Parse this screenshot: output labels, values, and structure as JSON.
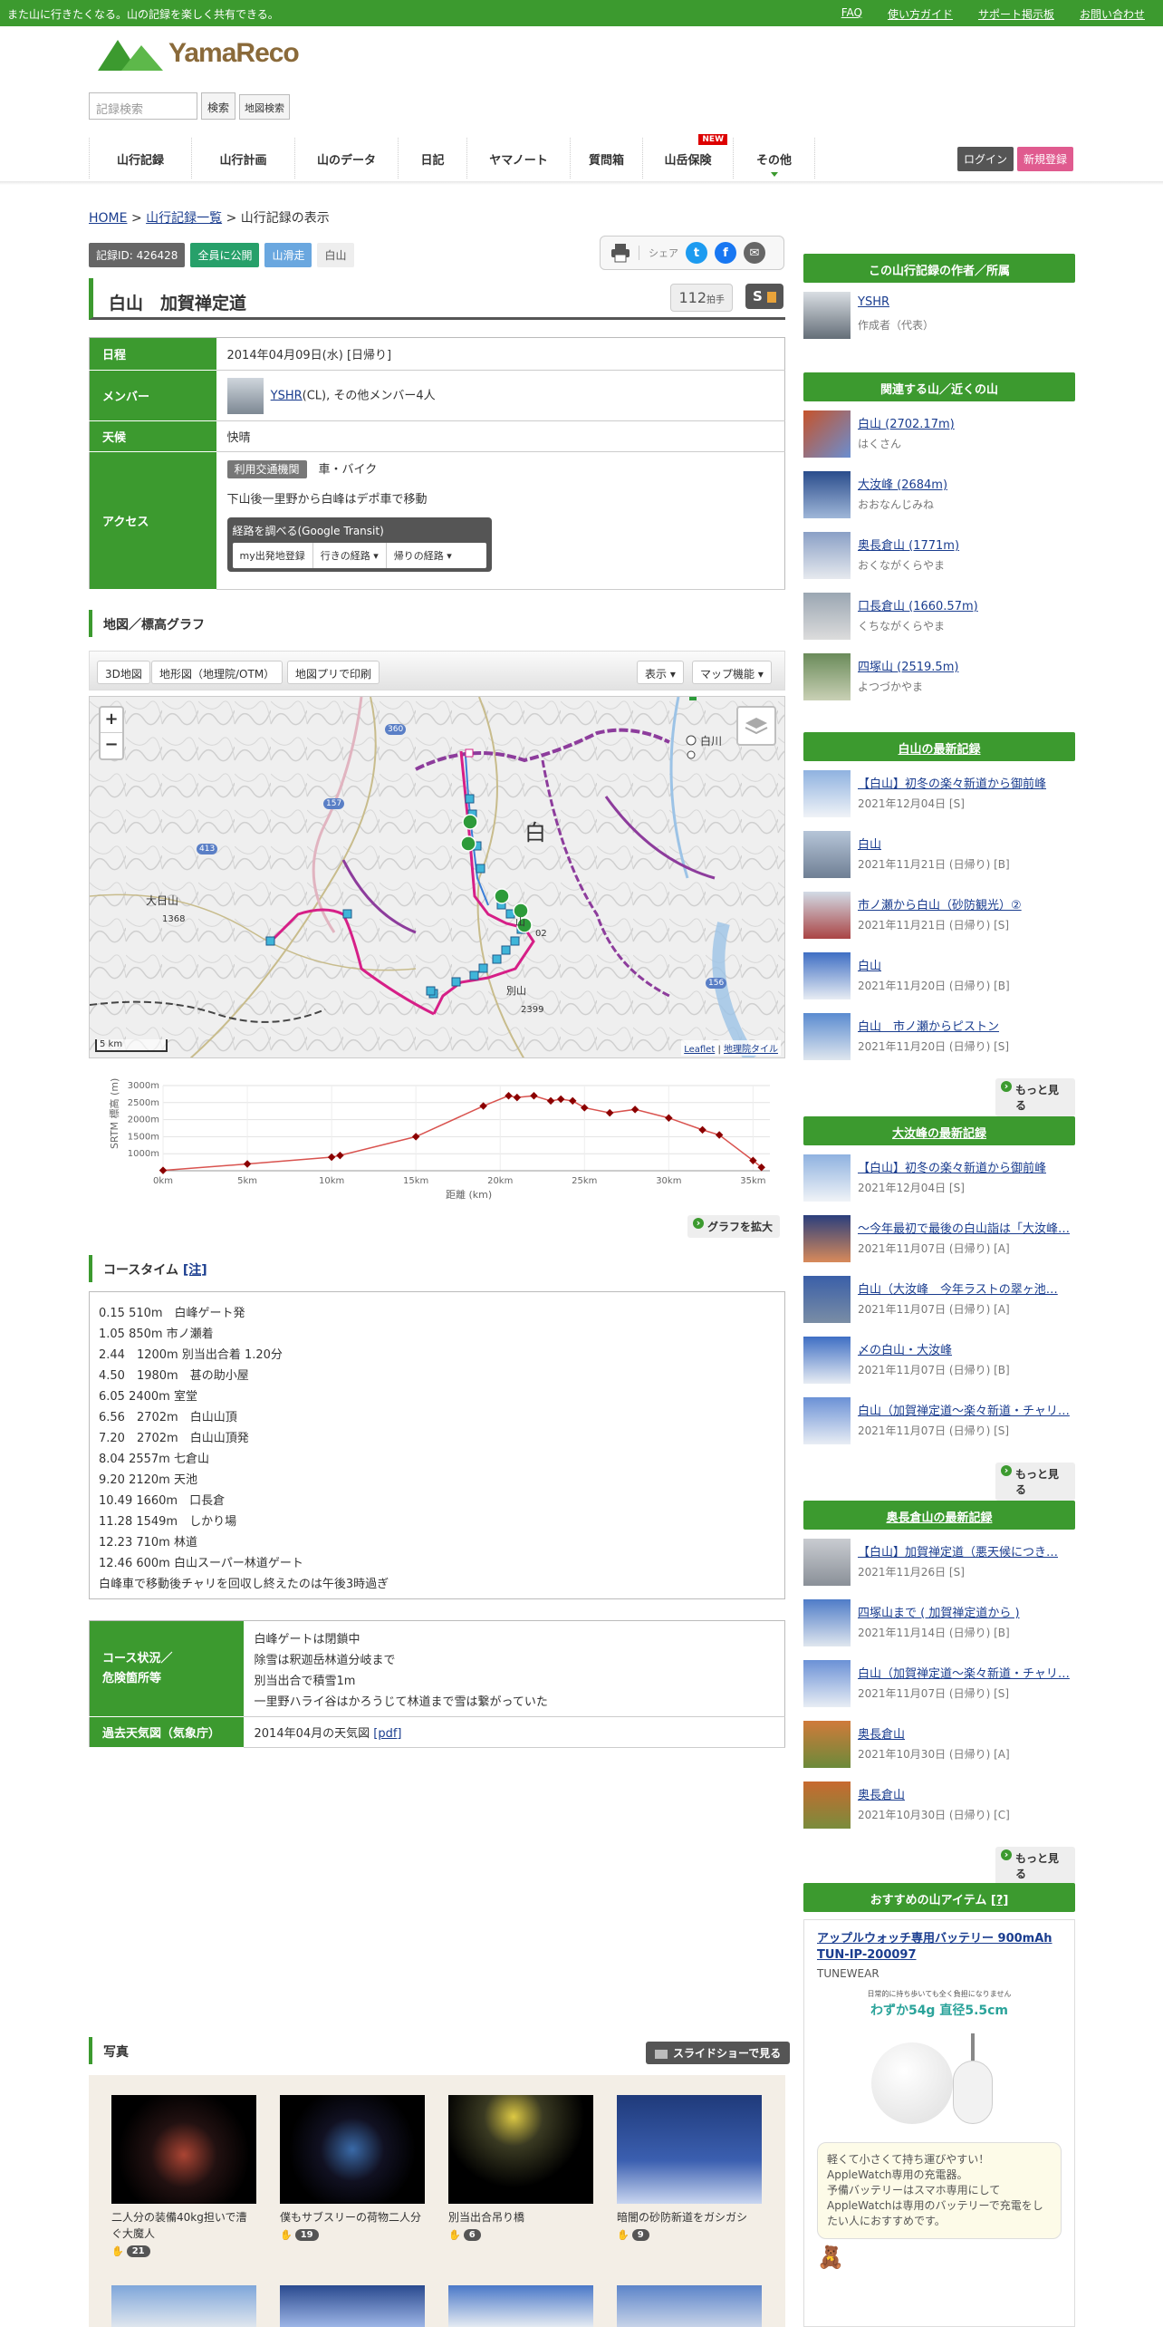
{
  "topbar": {
    "tagline": "また山に行きたくなる。山の記録を楽しく共有できる。",
    "links": [
      "FAQ",
      "使い方ガイド",
      "サポート掲示板",
      "お問い合わせ"
    ]
  },
  "logo": {
    "text": "YamaReco"
  },
  "search": {
    "placeholder": "記録検索",
    "button": "検索",
    "map_button": "地図検索"
  },
  "nav": {
    "items": [
      "山行記録",
      "山行計画",
      "山のデータ",
      "日記",
      "ヤマノート",
      "質問箱",
      "山岳保険",
      "その他"
    ],
    "new_badge": "NEW",
    "login": "ログイン",
    "signup": "新規登録"
  },
  "breadcrumb": {
    "home": "HOME",
    "list": "山行記録一覧",
    "sep": ">",
    "current": "山行記録の表示"
  },
  "badges": {
    "record_id": "記録ID: 426428",
    "public": "全員に公開",
    "type": "山滑走",
    "area": "白山"
  },
  "share": {
    "label": "シェア"
  },
  "record": {
    "title": "白山　加賀禅定道",
    "claps": "112",
    "claps_unit": "拍手",
    "grade": "S"
  },
  "info": {
    "date_label": "日程",
    "date": "2014年04月09日(水) [日帰り]",
    "member_label": "メンバー",
    "member_name": "YSHR",
    "member_rest": "(CL), その他メンバー4人",
    "weather_label": "天候",
    "weather": "快晴",
    "access_label": "アクセス",
    "transport_tag": "利用交通機関",
    "transport": "車・バイク",
    "access_note": "下山後一里野から白峰はデポ車で移動",
    "transit_title": "経路を調べる(Google Transit)",
    "transit_buttons": [
      "my出発地登録",
      "行きの経路 ▾",
      "帰りの経路 ▾"
    ]
  },
  "map_section": {
    "title": "地図／標高グラフ",
    "tools": [
      "3D地図",
      "地形図（地理院/OTM）",
      "地図プリで印刷"
    ],
    "right_tools": [
      "表示 ▾",
      "マップ機能 ▾"
    ],
    "zoom_in": "+",
    "zoom_out": "−",
    "scale": "5 km",
    "attribution_a": "Leaflet",
    "attribution_sep": " | ",
    "attribution_b": "地理院タイル",
    "labels": {
      "daishozan": "大日山",
      "peak1368": "1368",
      "shirakawa": "白川",
      "haku": "白",
      "bessan": "別山",
      "peak2399": "2399",
      "peak02": "02",
      "yama": "山",
      "r360": "360",
      "r157": "157",
      "r156": "156",
      "r413": "413"
    },
    "expand_graph": "グラフを拡大"
  },
  "chart_data": {
    "type": "line",
    "title": "",
    "xlabel": "距離 (km)",
    "ylabel": "SRTM 標高 (m)",
    "xlim": [
      0,
      36
    ],
    "ylim": [
      500,
      3000
    ],
    "x_ticks": [
      "0km",
      "5km",
      "10km",
      "15km",
      "20km",
      "25km",
      "30km",
      "35km"
    ],
    "y_ticks": [
      "1000m",
      "1500m",
      "2000m",
      "2500m",
      "3000m"
    ],
    "x": [
      0,
      5,
      10,
      10.5,
      15,
      19,
      20.5,
      21,
      22,
      23,
      23.6,
      24.3,
      25,
      26.5,
      28,
      30,
      32,
      33,
      35,
      35.5
    ],
    "y": [
      510,
      700,
      900,
      950,
      1500,
      2400,
      2702,
      2650,
      2700,
      2550,
      2600,
      2550,
      2350,
      2200,
      2300,
      2050,
      1700,
      1550,
      800,
      600
    ]
  },
  "course_time": {
    "title": "コースタイム",
    "note": "[注]",
    "lines": [
      "0.15 510m　白峰ゲート発",
      "1.05 850m 市ノ瀬着",
      "2.44　1200m 別当出合着 1.20分",
      "4.50　1980m　甚の助小屋",
      "6.05 2400m 室堂",
      "6.56　2702m　白山山頂",
      "7.20　2702m　白山山頂発",
      "8.04 2557m 七倉山",
      "9.20 2120m 天池",
      "10.49 1660m　口長倉",
      "11.28 1549m　しかり場",
      "12.23 710m 林道",
      "12.46 600m 白山スーパー林道ゲート",
      "白峰車で移動後チャリを回収し終えたのは午後3時過ぎ"
    ]
  },
  "conditions": {
    "label": "コース状況／\n危険箇所等",
    "lines": [
      "白峰ゲートは閉鎖中",
      "除雪は釈迦岳林道分岐まで",
      "別当出合で積雪1m",
      "一里野ハライ谷はかろうじて林道まで雪は繋がっていた"
    ],
    "weather_label": "過去天気図（気象庁）",
    "weather_value": "2014年04月の天気図",
    "weather_pdf": "[pdf]"
  },
  "photos": {
    "title": "写真",
    "slideshow": "スライドショーで見る",
    "items": [
      {
        "caption": "二人分の装備40kg担いで漕ぐ大魔人",
        "likes": "21"
      },
      {
        "caption": "僕もサブスリーの荷物二人分",
        "likes": "19"
      },
      {
        "caption": "別当出合吊り橋",
        "likes": "6"
      },
      {
        "caption": "暗闇の砂防新道をガシガシ",
        "likes": "9"
      }
    ]
  },
  "sidebar": {
    "author": {
      "title": "この山行記録の作者／所属",
      "name": "YSHR",
      "role": "作成者（代表）"
    },
    "related": {
      "title": "関連する山／近くの山",
      "items": [
        {
          "name": "白山 (2702.17m)",
          "reading": "はくさん"
        },
        {
          "name": "大汝峰 (2684m)",
          "reading": "おおなんじみね"
        },
        {
          "name": "奥長倉山 (1771m)",
          "reading": "おくながくらやま"
        },
        {
          "name": "口長倉山 (1660.57m)",
          "reading": "くちながくらやま"
        },
        {
          "name": "四塚山 (2519.5m)",
          "reading": "よつづかやま"
        }
      ]
    },
    "latest1": {
      "title": "白山の最新記録",
      "items": [
        {
          "name": "【白山】初冬の楽々新道から御前峰",
          "meta": "2021年12月04日 [S]"
        },
        {
          "name": "白山",
          "meta": "2021年11月21日 (日帰り) [B]"
        },
        {
          "name": "市ノ瀬から白山（砂防観光）②",
          "meta": "2021年11月21日 (日帰り) [S]"
        },
        {
          "name": "白山",
          "meta": "2021年11月20日 (日帰り) [B]"
        },
        {
          "name": "白山　市ノ瀬からピストン",
          "meta": "2021年11月20日 (日帰り) [S]"
        }
      ],
      "more": "もっと見る"
    },
    "latest2": {
      "title": "大汝峰の最新記録",
      "items": [
        {
          "name": "【白山】初冬の楽々新道から御前峰",
          "meta": "2021年12月04日 [S]"
        },
        {
          "name": "～今年最初で最後の白山詣は「大汝峰…",
          "meta": "2021年11月07日 (日帰り) [A]"
        },
        {
          "name": "白山（大汝峰　今年ラストの翠ヶ池…",
          "meta": "2021年11月07日 (日帰り) [A]"
        },
        {
          "name": "〆の白山・大汝峰",
          "meta": "2021年11月07日 (日帰り) [B]"
        },
        {
          "name": "白山（加賀禅定道～楽々新道・チャリ…",
          "meta": "2021年11月07日 (日帰り) [S]"
        }
      ],
      "more": "もっと見る"
    },
    "latest3": {
      "title": "奥長倉山の最新記録",
      "items": [
        {
          "name": "【白山】加賀禅定道（悪天候につき…",
          "meta": "2021年11月26日 [S]"
        },
        {
          "name": "四塚山まで ( 加賀禅定道から )",
          "meta": "2021年11月14日 (日帰り) [B]"
        },
        {
          "name": "白山（加賀禅定道～楽々新道・チャリ…",
          "meta": "2021年11月07日 (日帰り) [S]"
        },
        {
          "name": "奥長倉山",
          "meta": "2021年10月30日 (日帰り) [A]"
        },
        {
          "name": "奥長倉山",
          "meta": "2021年10月30日 (日帰り) [C]"
        }
      ],
      "more": "もっと見る"
    },
    "item_ad": {
      "title": "おすすめの山アイテム",
      "note": "[?]",
      "product": "アップルウォッチ専用バッテリー 900mAh TUN-IP-200097",
      "brand": "TUNEWEAR",
      "ad_line1": "日常的に持ち歩いても全く負担になりません",
      "ad_line2": "わずか54g 直径5.5cm",
      "desc": "軽くて小さくて持ち運びやすい！\nAppleWatch専用の充電器。\n予備バッテリーはスマホ専用にして\nAppleWatchは専用のバッテリーで充電をしたい人におすすめです。"
    }
  }
}
